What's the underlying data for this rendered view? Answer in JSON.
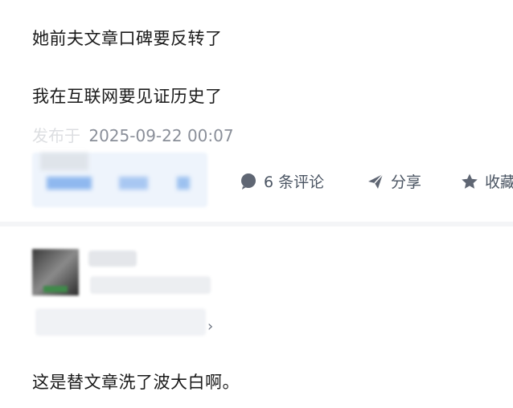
{
  "post": {
    "line1": "她前夫文章口碑要反转了",
    "line2": "我在互联网要见证历史了",
    "timestamp_prefix": "发布于",
    "timestamp": "2025-09-22 00:07"
  },
  "actions": {
    "comments_label": "6 条评论",
    "share_label": "分享",
    "favorite_label": "收藏"
  },
  "comment": {
    "more_chevron": "›",
    "reply_text": "这是替文章洗了波大白啊。"
  }
}
